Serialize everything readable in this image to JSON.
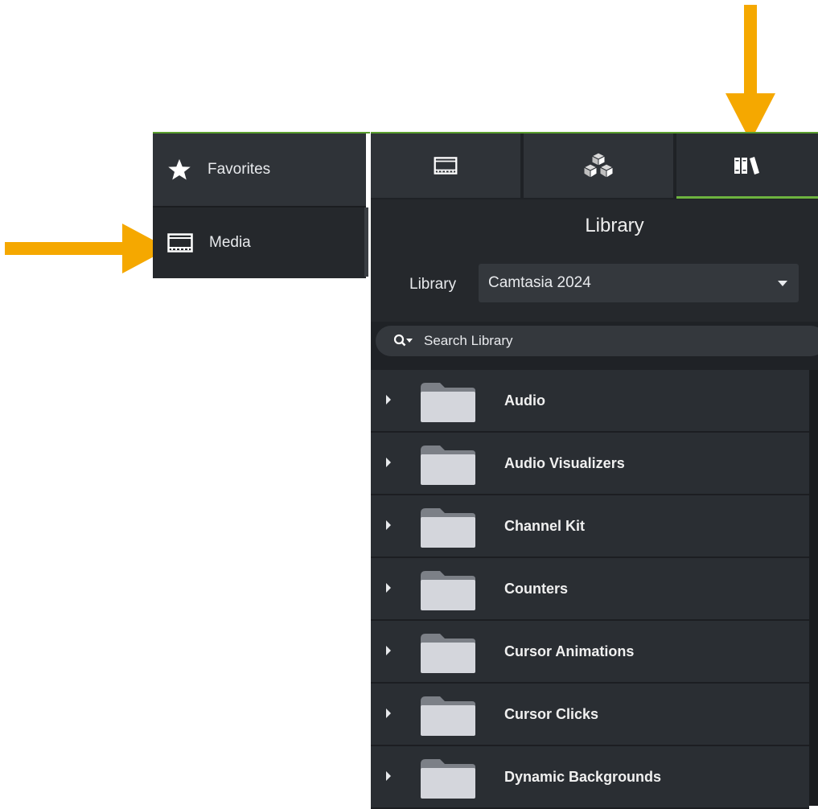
{
  "sidebar": {
    "items": [
      {
        "label": "Favorites",
        "icon": "star-icon"
      },
      {
        "label": "Media",
        "icon": "film-icon"
      }
    ]
  },
  "tabs": [
    {
      "icon": "film-icon"
    },
    {
      "icon": "cubes-icon"
    },
    {
      "icon": "library-books-icon",
      "active": true
    }
  ],
  "library": {
    "title": "Library",
    "selector_label": "Library",
    "selected": "Camtasia 2024"
  },
  "search": {
    "placeholder": "Search Library"
  },
  "folders": [
    "Audio",
    "Audio Visualizers",
    "Channel Kit",
    "Counters",
    "Cursor Animations",
    "Cursor Clicks",
    "Dynamic Backgrounds"
  ],
  "colors": {
    "accent_green": "#6db33f",
    "annotation_arrow": "#f5a800"
  }
}
